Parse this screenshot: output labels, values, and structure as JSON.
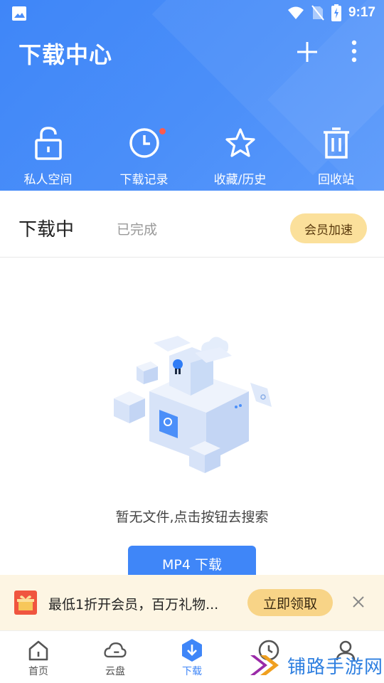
{
  "status_bar": {
    "time": "9:17"
  },
  "header": {
    "title": "下载中心",
    "quick_actions": [
      {
        "label": "私人空间",
        "icon": "lock-open-icon"
      },
      {
        "label": "下载记录",
        "icon": "clock-icon"
      },
      {
        "label": "收藏/历史",
        "icon": "star-icon"
      },
      {
        "label": "回收站",
        "icon": "trash-icon"
      }
    ]
  },
  "tabs": {
    "active": "下载中",
    "done": "已完成",
    "vip_button": "会员加速"
  },
  "empty_state": {
    "message": "暂无文件,点击按钮去搜索",
    "button": "MP4 下载"
  },
  "promo": {
    "text": "最低1折开会员，百万礼物...",
    "claim_button": "立即领取"
  },
  "bottom_nav": [
    {
      "label": "首页",
      "icon": "home-icon"
    },
    {
      "label": "云盘",
      "icon": "cloud-icon"
    },
    {
      "label": "下载",
      "icon": "download-icon"
    },
    {
      "label": "",
      "icon": "clock-icon"
    },
    {
      "label": "",
      "icon": "user-icon"
    }
  ],
  "watermark": {
    "text": "铺路手游网"
  },
  "colors": {
    "primary": "#3f86f8",
    "vip": "#fbe09b",
    "promo_bg": "#fdf5e3",
    "claim": "#f8d487",
    "badge": "#ff5b4d"
  }
}
